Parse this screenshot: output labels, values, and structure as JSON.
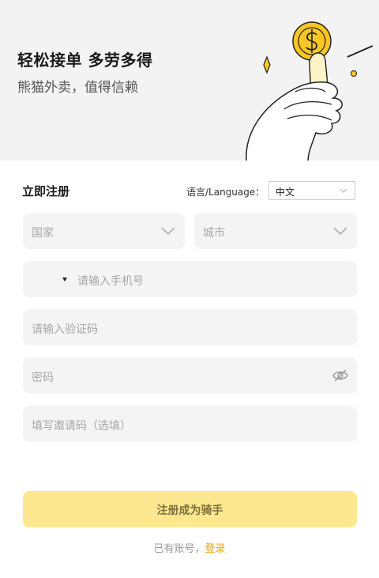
{
  "hero": {
    "title": "轻松接单 多劳多得",
    "subtitle": "熊猫外卖，值得信赖",
    "illustration": "hand-holding-coin"
  },
  "form": {
    "title": "立即注册",
    "language_label": "语言/Language：",
    "language_value": "中文",
    "country_placeholder": "国家",
    "city_placeholder": "城市",
    "phone_placeholder": "请输入手机号",
    "code_placeholder": "请输入验证码",
    "password_placeholder": "密码",
    "invite_placeholder": "填写邀请码（选填）",
    "submit_label": "注册成为骑手",
    "login_prompt": "已有账号，",
    "login_link": "登录"
  },
  "colors": {
    "accent": "#f0a400",
    "submit_bg": "#fde890",
    "field_bg": "#f4f4f4",
    "hero_bg": "#f3f3f3",
    "coin": "#f9c623"
  },
  "icons": [
    "chevron-down-icon",
    "eye-off-icon",
    "dropdown-caret-icon",
    "dollar-coin-icon"
  ]
}
